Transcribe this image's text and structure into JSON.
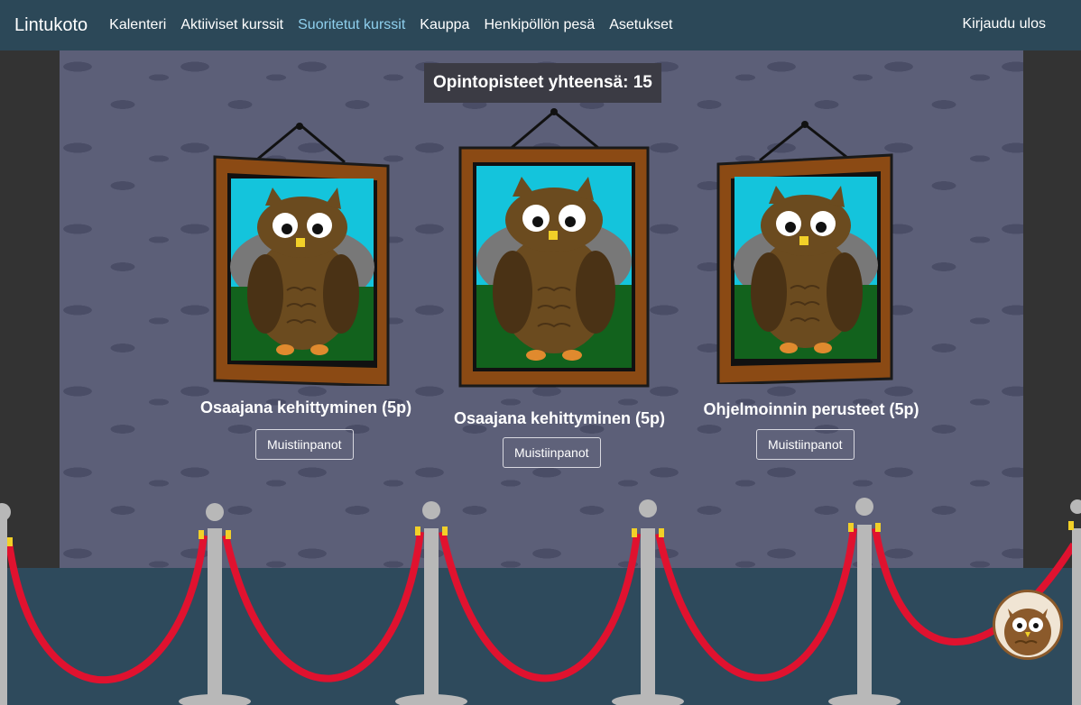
{
  "nav": {
    "brand": "Lintukoto",
    "items": [
      {
        "label": "Kalenteri"
      },
      {
        "label": "Aktiiviset kurssit"
      },
      {
        "label": "Suoritetut kurssit"
      },
      {
        "label": "Kauppa"
      },
      {
        "label": "Henkipöllön pesä"
      },
      {
        "label": "Asetukset"
      }
    ],
    "logout": "Kirjaudu ulos"
  },
  "credits": "Opintopisteet yhteensä: 15",
  "paintings": [
    {
      "title": "Osaajana kehittyminen (5p)",
      "button": "Muistiinpanot"
    },
    {
      "title": "Osaajana kehittyminen (5p)",
      "button": "Muistiinpanot"
    },
    {
      "title": "Ohjelmoinnin perusteet (5p)",
      "button": "Muistiinpanot"
    }
  ],
  "colors": {
    "navbar": "#2c4858",
    "active_link": "#8fd0ee",
    "wall": "#5c5f78",
    "floor": "#2e4a5c",
    "rope": "#e0122f",
    "frame": "#8b4a14"
  },
  "icons": {
    "avatar": "owl-avatar-icon",
    "painting": "sad-owl-painting"
  }
}
